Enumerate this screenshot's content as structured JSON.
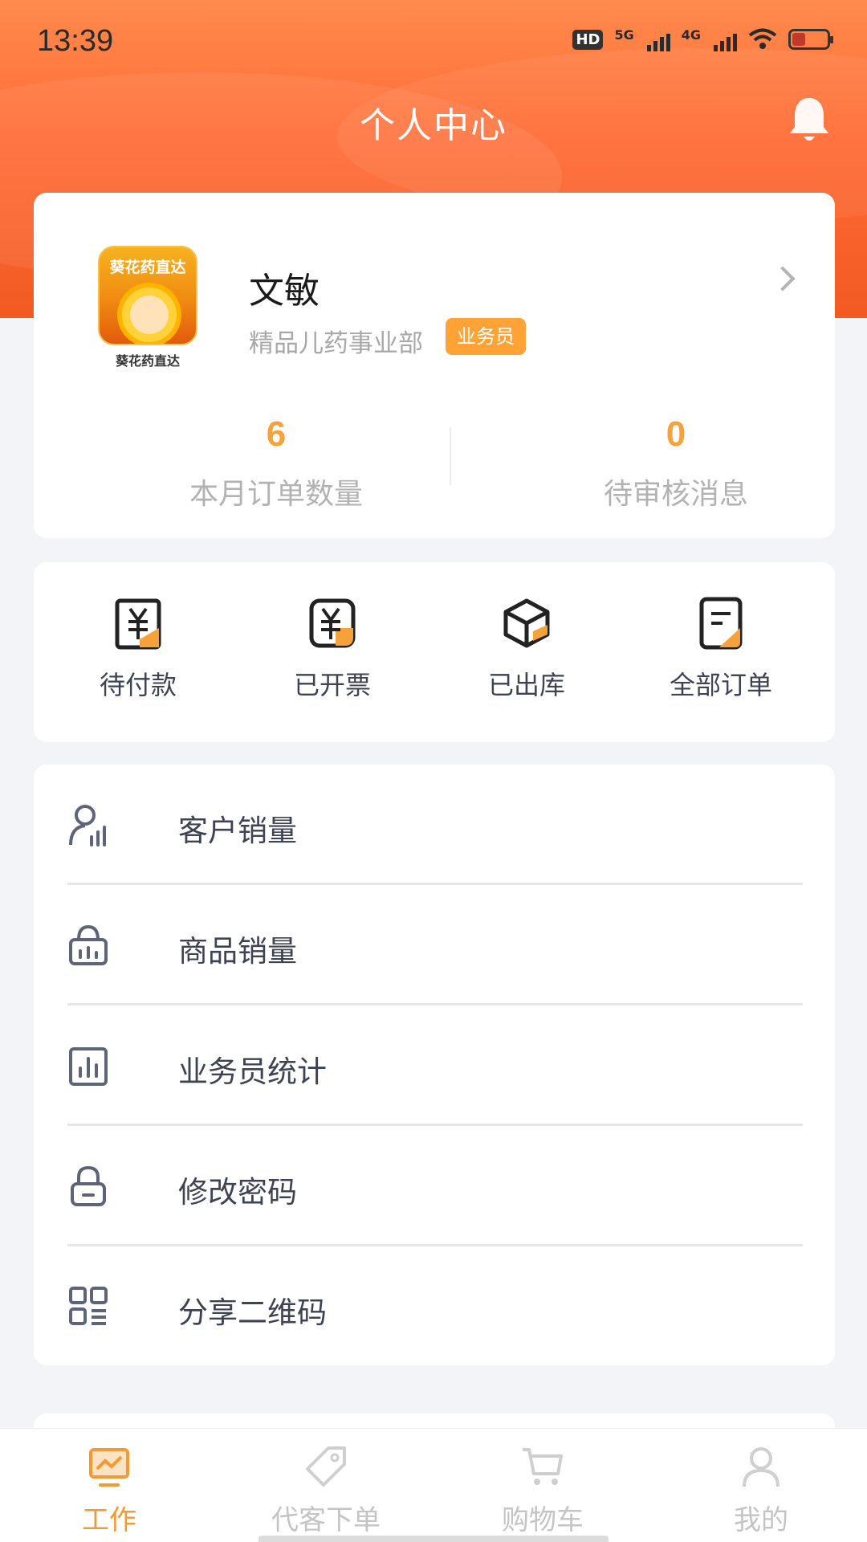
{
  "status_bar": {
    "time": "13:39",
    "hd_badge": "HD",
    "net1": "5G",
    "net2": "4G"
  },
  "header": {
    "title": "个人中心"
  },
  "profile": {
    "avatar_brand": "葵花药直达",
    "avatar_caption": "葵花药直达",
    "name": "文敏",
    "department": "精品儿药事业部",
    "role": "业务员"
  },
  "stats": [
    {
      "value": "6",
      "label": "本月订单数量"
    },
    {
      "value": "0",
      "label": "待审核消息"
    }
  ],
  "orders": [
    {
      "label": "待付款",
      "icon": "payment-receipt-icon"
    },
    {
      "label": "已开票",
      "icon": "invoice-icon"
    },
    {
      "label": "已出库",
      "icon": "box-icon"
    },
    {
      "label": "全部订单",
      "icon": "order-list-icon"
    }
  ],
  "menu": [
    {
      "label": "客户销量",
      "icon": "customer-chart-icon"
    },
    {
      "label": "商品销量",
      "icon": "basket-icon"
    },
    {
      "label": "业务员统计",
      "icon": "bar-chart-icon"
    },
    {
      "label": "修改密码",
      "icon": "lock-icon"
    },
    {
      "label": "分享二维码",
      "icon": "qr-grid-icon"
    }
  ],
  "tabs": [
    {
      "label": "工作",
      "icon": "monitor-chart-icon",
      "active": true
    },
    {
      "label": "代客下单",
      "icon": "tag-icon",
      "active": false
    },
    {
      "label": "购物车",
      "icon": "cart-icon",
      "active": false
    },
    {
      "label": "我的",
      "icon": "user-icon",
      "active": false
    }
  ],
  "colors": {
    "header_orange": "#ff6b35",
    "accent_orange": "#f5a23b",
    "badge_orange": "#ffa336",
    "tab_active": "#f39a31",
    "text_dark": "#3d4353"
  }
}
